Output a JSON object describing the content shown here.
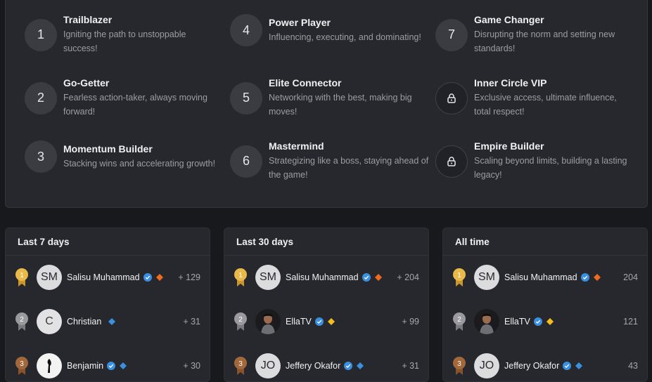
{
  "levels": [
    {
      "badge": "1",
      "title": "Trailblazer",
      "desc": "Igniting the path to unstoppable success!",
      "locked": false
    },
    {
      "badge": "2",
      "title": "Go-Getter",
      "desc": "Fearless action-taker, always moving forward!",
      "locked": false
    },
    {
      "badge": "3",
      "title": "Momentum Builder",
      "desc": "Stacking wins and accelerating growth!",
      "locked": false
    },
    {
      "badge": "4",
      "title": "Power Player",
      "desc": "Influencing, executing, and dominating!",
      "locked": false
    },
    {
      "badge": "5",
      "title": "Elite Connector",
      "desc": "Networking with the best, making big moves!",
      "locked": false
    },
    {
      "badge": "6",
      "title": "Mastermind",
      "desc": "Strategizing like a boss, staying ahead of the game!",
      "locked": false
    },
    {
      "badge": "7",
      "title": "Game Changer",
      "desc": "Disrupting the norm and setting new standards!",
      "locked": false
    },
    {
      "badge": "",
      "title": "Inner Circle VIP",
      "desc": "Exclusive access, ultimate influence, total respect!",
      "locked": true
    },
    {
      "badge": "",
      "title": "Empire Builder",
      "desc": "Scaling beyond limits, building a lasting legacy!",
      "locked": true
    }
  ],
  "boards": [
    {
      "title": "Last 7 days",
      "rows": [
        {
          "rank": "1",
          "avatar": "SM",
          "name": "Salisu Muhammad",
          "points": "+ 129",
          "verified": true,
          "diamond": "orange"
        },
        {
          "rank": "2",
          "avatar": "C",
          "name": "Christian",
          "points": "+ 31",
          "verified": false,
          "diamond": "blue"
        },
        {
          "rank": "3",
          "avatar": "",
          "name": "Benjamin",
          "points": "+ 30",
          "verified": true,
          "diamond": "blue"
        }
      ]
    },
    {
      "title": "Last 30 days",
      "rows": [
        {
          "rank": "1",
          "avatar": "SM",
          "name": "Salisu Muhammad",
          "points": "+ 204",
          "verified": true,
          "diamond": "orange"
        },
        {
          "rank": "2",
          "avatar": "",
          "name": "EllaTV",
          "points": "+ 99",
          "verified": true,
          "diamond": "gold"
        },
        {
          "rank": "3",
          "avatar": "JO",
          "name": "Jeffery Okafor",
          "points": "+ 31",
          "verified": true,
          "diamond": "blue"
        }
      ]
    },
    {
      "title": "All time",
      "rows": [
        {
          "rank": "1",
          "avatar": "SM",
          "name": "Salisu Muhammad",
          "points": "204",
          "verified": true,
          "diamond": "orange"
        },
        {
          "rank": "2",
          "avatar": "",
          "name": "EllaTV",
          "points": "121",
          "verified": true,
          "diamond": "gold"
        },
        {
          "rank": "3",
          "avatar": "JO",
          "name": "Jeffery Okafor",
          "points": "43",
          "verified": true,
          "diamond": "blue"
        }
      ]
    }
  ],
  "colors": {
    "verified": "#3b8fe0",
    "diamond_orange": "#f06a1e",
    "diamond_blue": "#3b8fe0",
    "diamond_gold": "#f2c01d",
    "medal_gold": "#e9b949",
    "medal_silver": "#9a9a9e",
    "medal_bronze": "#a2683c"
  }
}
